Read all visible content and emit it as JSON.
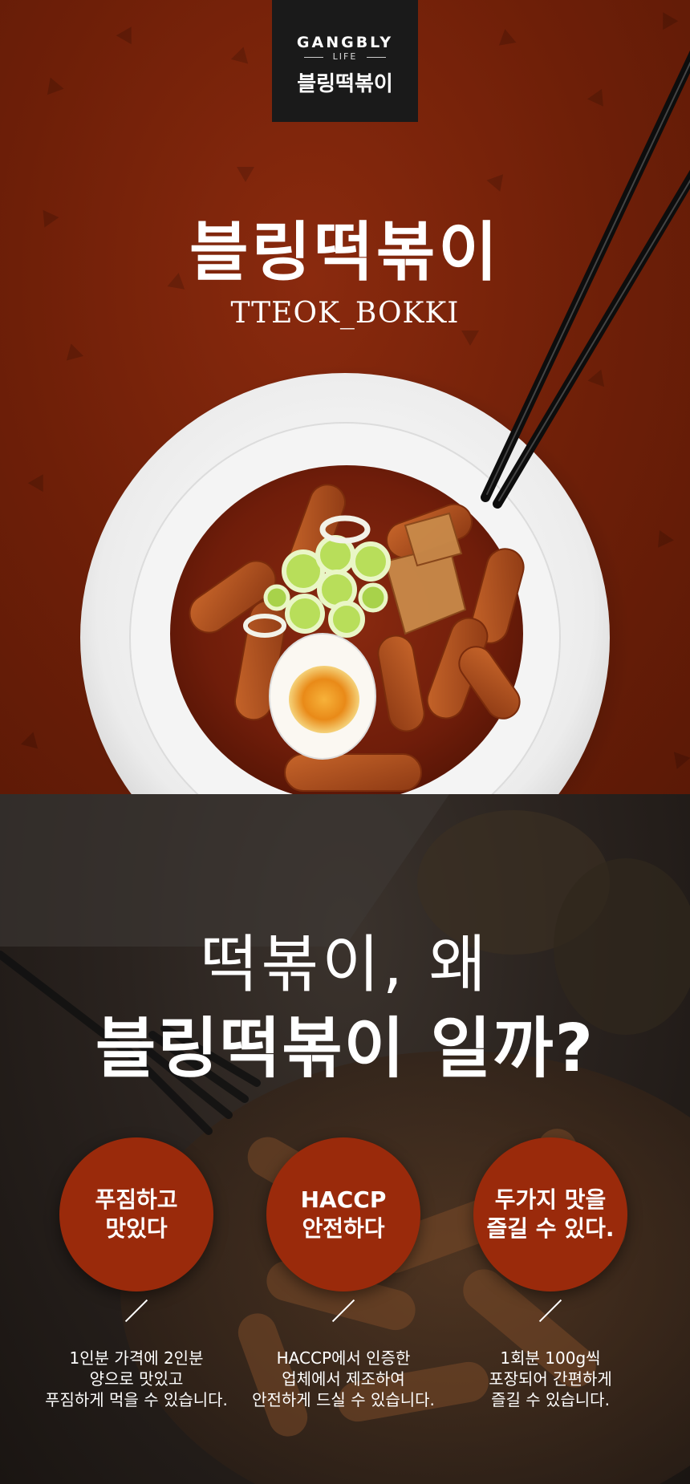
{
  "logo": {
    "brand": "GANGBLY",
    "sub": "LIFE",
    "korean": "블링떡볶이"
  },
  "hero": {
    "title": "블링떡볶이",
    "subtitle": "TTEOK_BOKKI"
  },
  "why": {
    "question_line1": "떡볶이, 왜",
    "question_line2": "블링떡볶이 일까?",
    "features": [
      {
        "title_lines": [
          "푸짐하고",
          "맛있다"
        ],
        "desc_lines": [
          "1인분 가격에 2인분",
          "양으로 맛있고",
          "푸짐하게 먹을 수 있습니다."
        ]
      },
      {
        "title_lines": [
          "HACCP",
          "안전하다"
        ],
        "desc_lines": [
          "HACCP에서 인증한",
          "업체에서 제조하여",
          "안전하게 드실 수 있습니다."
        ]
      },
      {
        "title_lines": [
          "두가지 맛을",
          "즐길 수 있다."
        ],
        "desc_lines": [
          "1회분 100g씩",
          "포장되어 간편하게",
          "즐길 수 있습니다."
        ]
      }
    ]
  },
  "colors": {
    "hero_bg": "#6e1f08",
    "accent_circle": "#9a2a0b",
    "logo_bg": "#1a1a1a"
  },
  "icons": [
    "chopsticks-icon",
    "divider-slash-icon"
  ]
}
